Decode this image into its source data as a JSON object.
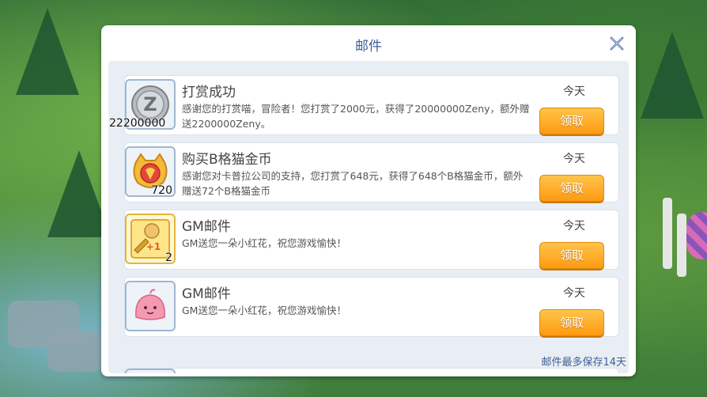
{
  "modal": {
    "title": "邮件",
    "footer_note": "邮件最多保存14天",
    "claim_label": "领取"
  },
  "mails": [
    {
      "title": "打赏成功",
      "body": "感谢您的打赏喵，冒险者！您打赏了2000元，获得了20000000Zeny，额外赠送2200000Zeny。",
      "date": "今天",
      "item_qty": "22200000",
      "icon": "zeny-coin-icon"
    },
    {
      "title": "购买B格猫金币",
      "body": "感谢您对卡普拉公司的支持，您打赏了648元，获得了648个B格猫金币，额外赠送72个B格猫金币",
      "date": "今天",
      "item_qty": "720",
      "icon": "cat-coin-icon"
    },
    {
      "title": "GM邮件",
      "body": "GM送您一朵小红花，祝您游戏愉快！",
      "date": "今天",
      "item_qty": "2",
      "icon": "upgrade-card-icon"
    },
    {
      "title": "GM邮件",
      "body": "GM送您一朵小红花，祝您游戏愉快！",
      "date": "今天",
      "item_qty": "",
      "icon": "pink-poring-icon"
    }
  ],
  "colors": {
    "accent": "#3f5f98",
    "button": "#ff9a12"
  }
}
